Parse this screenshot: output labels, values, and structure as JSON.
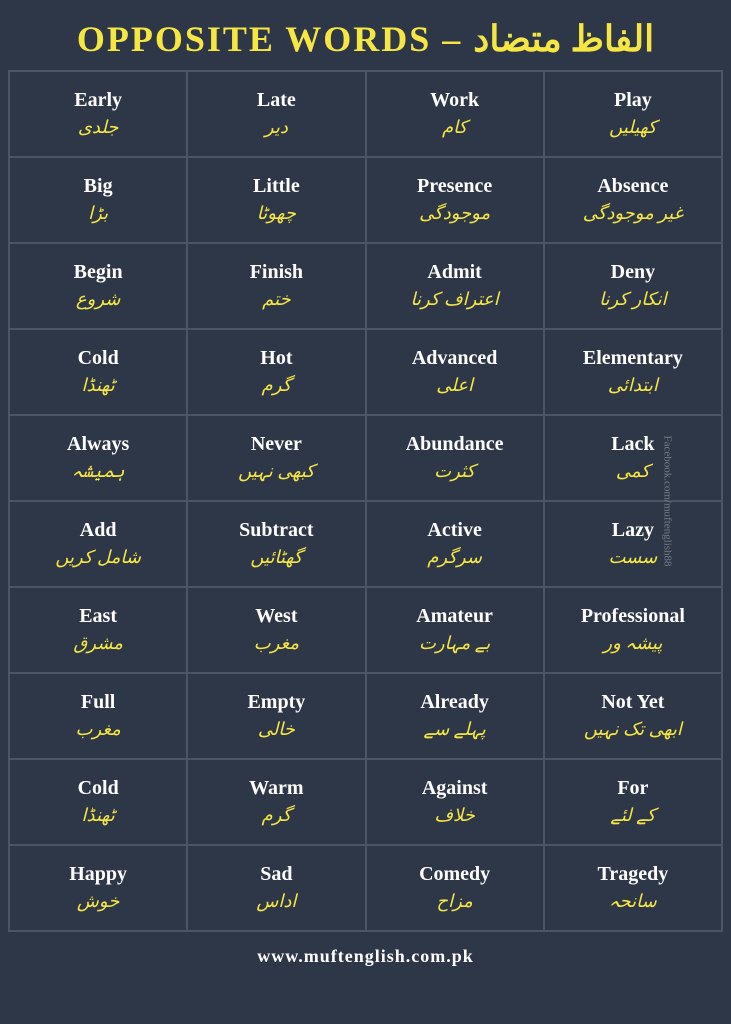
{
  "header": {
    "title": "OPPOSITE WORDS – الفاظ متضاد"
  },
  "cells": [
    {
      "english": "Early",
      "urdu": "جلدی"
    },
    {
      "english": "Late",
      "urdu": "دیر"
    },
    {
      "english": "Work",
      "urdu": "کام"
    },
    {
      "english": "Play",
      "urdu": "کھیلیں"
    },
    {
      "english": "Big",
      "urdu": "بڑا"
    },
    {
      "english": "Little",
      "urdu": "چھوٹا"
    },
    {
      "english": "Presence",
      "urdu": "موجودگی"
    },
    {
      "english": "Absence",
      "urdu": "غیر موجودگی"
    },
    {
      "english": "Begin",
      "urdu": "شروع"
    },
    {
      "english": "Finish",
      "urdu": "ختم"
    },
    {
      "english": "Admit",
      "urdu": "اعتراف کرنا"
    },
    {
      "english": "Deny",
      "urdu": "انکار کرنا"
    },
    {
      "english": "Cold",
      "urdu": "ٹھنڈا"
    },
    {
      "english": "Hot",
      "urdu": "گرم"
    },
    {
      "english": "Advanced",
      "urdu": "اعلی"
    },
    {
      "english": "Elementary",
      "urdu": "ابتدائی"
    },
    {
      "english": "Always",
      "urdu": "ہمیشہ"
    },
    {
      "english": "Never",
      "urdu": "کبھی نہیں"
    },
    {
      "english": "Abundance",
      "urdu": "کثرت"
    },
    {
      "english": "Lack",
      "urdu": "کمی"
    },
    {
      "english": "Add",
      "urdu": "شامل کریں"
    },
    {
      "english": "Subtract",
      "urdu": "گھٹائیں"
    },
    {
      "english": "Active",
      "urdu": "سرگرم"
    },
    {
      "english": "Lazy",
      "urdu": "سست"
    },
    {
      "english": "East",
      "urdu": "مشرق"
    },
    {
      "english": "West",
      "urdu": "مغرب"
    },
    {
      "english": "Amateur",
      "urdu": "بے مہارت"
    },
    {
      "english": "Professional",
      "urdu": "پیشہ ور"
    },
    {
      "english": "Full",
      "urdu": "مغرب"
    },
    {
      "english": "Empty",
      "urdu": "خالی"
    },
    {
      "english": "Already",
      "urdu": "پہلے سے"
    },
    {
      "english": "Not Yet",
      "urdu": "ابھی تک نہیں"
    },
    {
      "english": "Cold",
      "urdu": "ٹھنڈا"
    },
    {
      "english": "Warm",
      "urdu": "گرم"
    },
    {
      "english": "Against",
      "urdu": "خلاف"
    },
    {
      "english": "For",
      "urdu": "کے لئے"
    },
    {
      "english": "Happy",
      "urdu": "خوش"
    },
    {
      "english": "Sad",
      "urdu": "اداس"
    },
    {
      "english": "Comedy",
      "urdu": "مزاح"
    },
    {
      "english": "Tragedy",
      "urdu": "سانحہ"
    }
  ],
  "footer": {
    "url": "www.muftenglish.com.pk"
  },
  "watermark": {
    "fb": "Facebook.com/muftenglish88"
  }
}
